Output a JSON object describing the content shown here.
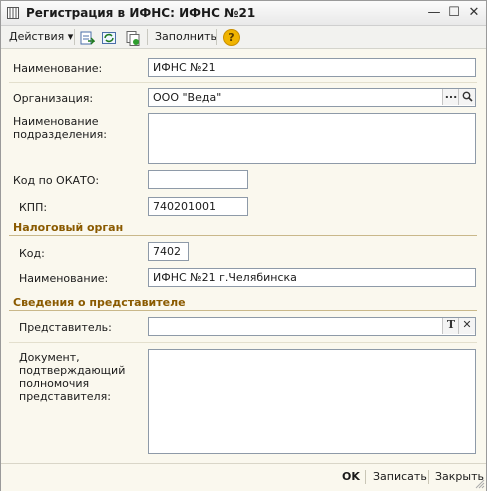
{
  "window": {
    "title": "Регистрация в ИФНС: ИФНС №21",
    "minimize_glyph": "—",
    "maximize_glyph": "☐",
    "close_glyph": "✕"
  },
  "toolbar": {
    "actions_label": "Действия",
    "actions_arrow": "▾",
    "fill_label": "Заполнить",
    "help_glyph": "?",
    "icons": [
      "post-icon",
      "refresh-icon",
      "copy-icon",
      "help-icon"
    ]
  },
  "form": {
    "name_label": "Наименование:",
    "name_value": "ИФНС №21",
    "org_label": "Организация:",
    "org_value": "ООО \"Веда\"",
    "org_select_glyph": "...",
    "subdivision_label": "Наименование подразделения:",
    "subdivision_value": "",
    "okato_label": "Код по ОКАТО:",
    "okato_value": "",
    "kpp_label": "КПП:",
    "kpp_value": "740201001"
  },
  "tax_authority": {
    "section_title": "Налоговый орган",
    "code_label": "Код:",
    "code_value": "7402",
    "name_label": "Наименование:",
    "name_value": "ИФНС №21 г.Челябинска"
  },
  "representative": {
    "section_title": "Сведения о представителе",
    "rep_label": "Представитель:",
    "rep_value": "",
    "type_glyph": "T",
    "clear_glyph": "✕",
    "doc_label": "Документ, подтверждающий полномочия представителя:",
    "doc_value": ""
  },
  "footer": {
    "ok_label": "OK",
    "save_label": "Записать",
    "close_label": "Закрыть"
  },
  "colors": {
    "window_bg": "#faf8ee",
    "section_title": "#8a5a00",
    "input_border": "#8e9aa8",
    "help_icon": "#f0b400"
  }
}
